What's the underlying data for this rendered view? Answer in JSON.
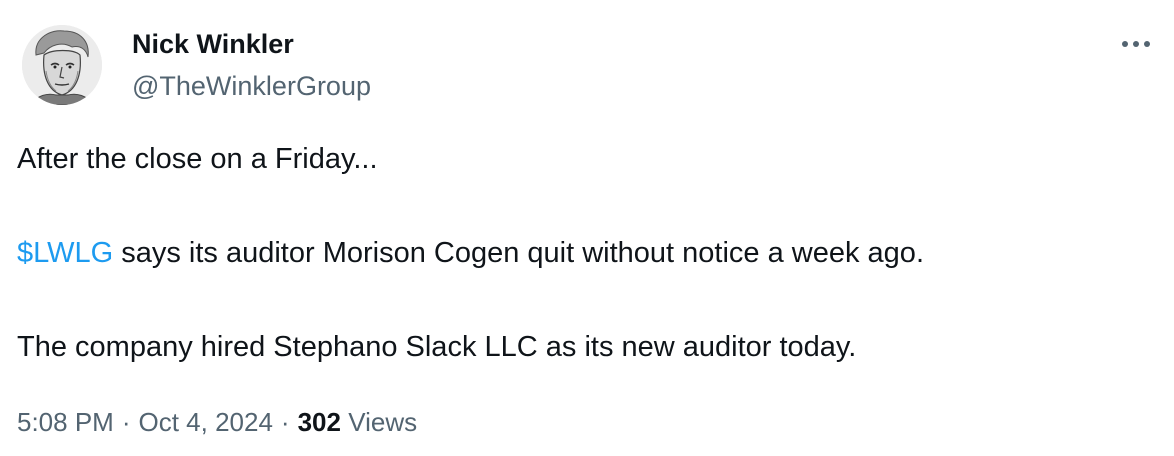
{
  "author": {
    "display_name": "Nick Winkler",
    "handle": "@TheWinklerGroup"
  },
  "more_icon": "more-horizontal-icon",
  "tweet": {
    "line1": "After the close on a Friday...",
    "cashtag": "$LWLG",
    "line2_rest": " says its auditor Morison Cogen quit without notice a week ago.",
    "line3": "The company hired Stephano Slack LLC as its new auditor today."
  },
  "meta": {
    "time": "5:08 PM",
    "separator": "·",
    "date": "Oct 4, 2024",
    "views_count": "302",
    "views_label": "Views"
  },
  "colors": {
    "text": "#0f1419",
    "secondary": "#536471",
    "link": "#1d9bf0"
  }
}
